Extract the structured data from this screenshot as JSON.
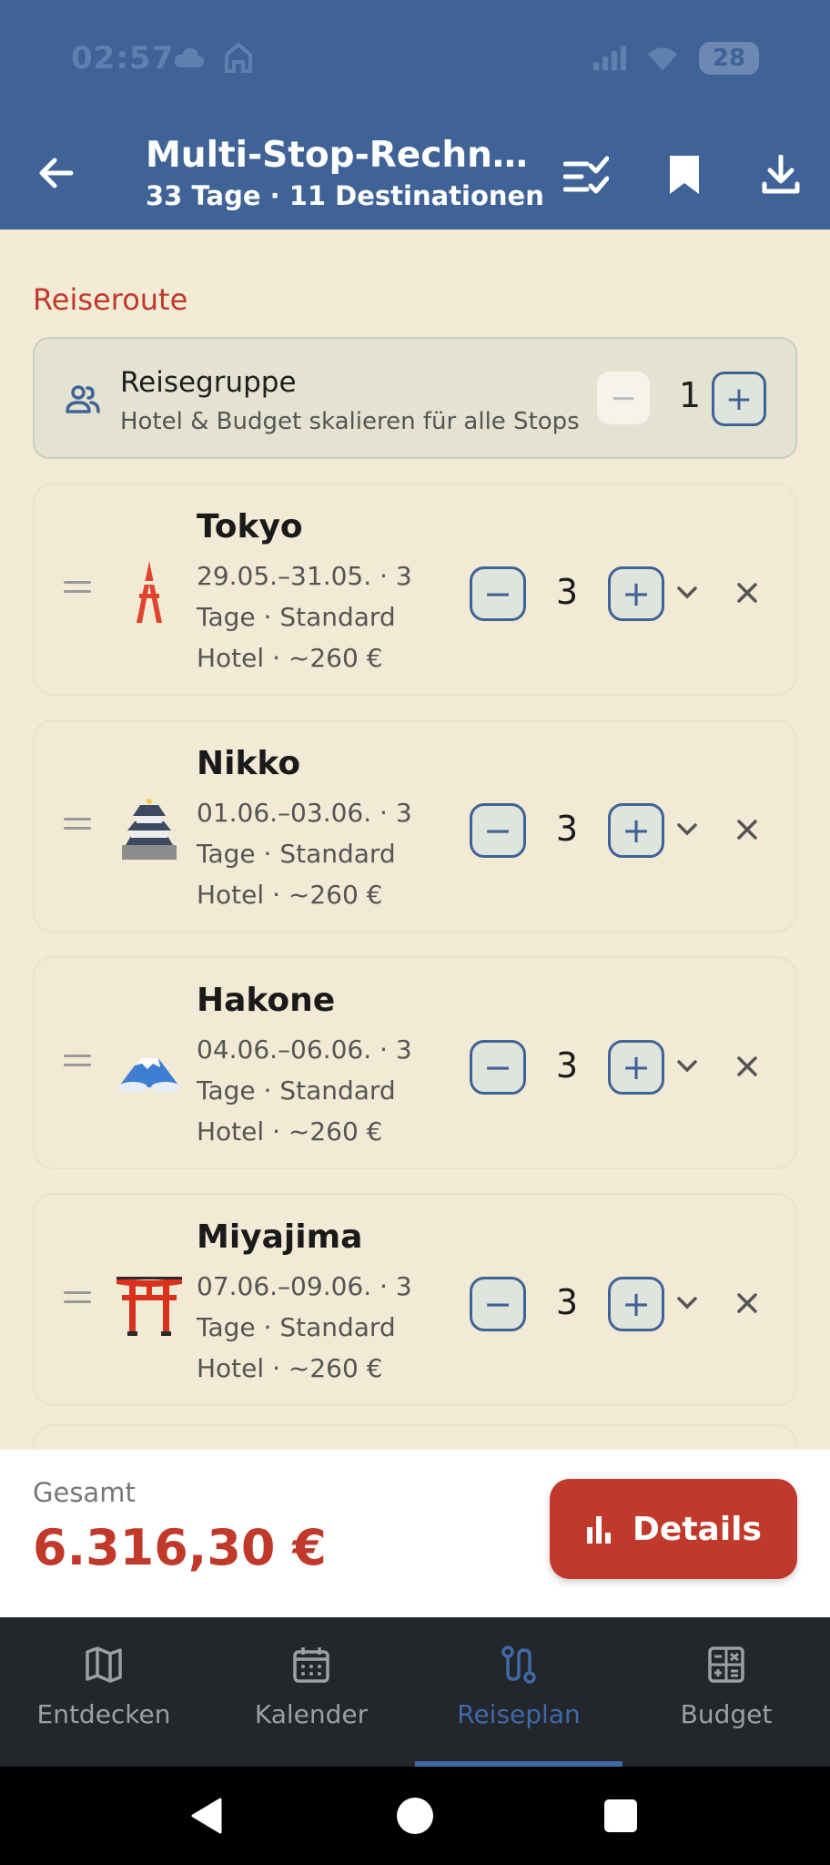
{
  "status": {
    "time": "02:57",
    "battery": "28"
  },
  "appbar": {
    "title": "Multi-Stop-Rechn…",
    "subtitle": "33 Tage · 11 Destinationen"
  },
  "section": {
    "title": "Reiseroute"
  },
  "group": {
    "title": "Reisegruppe",
    "subtitle": "Hotel & Budget skalieren für alle Stops",
    "count": "1",
    "minus": "−",
    "plus": "+"
  },
  "stops": [
    {
      "name": "Tokyo",
      "meta": "29.05.–31.05. · 3 Tage · Standard Hotel · ~260 €",
      "days": "3",
      "icon": "tokyo-tower-icon"
    },
    {
      "name": "Nikko",
      "meta": "01.06.–03.06. · 3 Tage · Standard Hotel · ~260 €",
      "days": "3",
      "icon": "castle-icon"
    },
    {
      "name": "Hakone",
      "meta": "04.06.–06.06. · 3 Tage · Standard Hotel · ~260 €",
      "days": "3",
      "icon": "mount-fuji-icon"
    },
    {
      "name": "Miyajima",
      "meta": "07.06.–09.06. · 3 Tage · Standard Hotel · ~260 €",
      "days": "3",
      "icon": "torii-gate-icon"
    }
  ],
  "stepper": {
    "minus": "−",
    "plus": "+"
  },
  "total": {
    "label": "Gesamt",
    "value": "6.316,30 €",
    "details_label": "Details"
  },
  "nav": {
    "items": [
      {
        "label": "Entdecken",
        "icon": "map-icon"
      },
      {
        "label": "Kalender",
        "icon": "calendar-icon"
      },
      {
        "label": "Reiseplan",
        "icon": "route-icon",
        "active": true
      },
      {
        "label": "Budget",
        "icon": "calculator-icon"
      }
    ]
  },
  "colors": {
    "primary": "#3f6396",
    "accent": "#c0392b",
    "background": "#f3ebd6",
    "nav_background": "#23262b"
  }
}
